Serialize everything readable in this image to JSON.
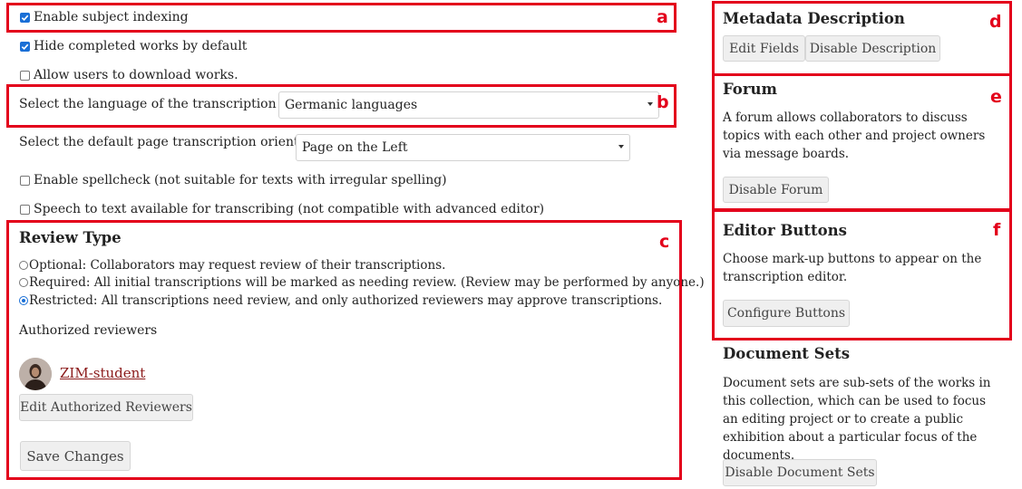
{
  "settings": {
    "enable_subject_indexing": "Enable subject indexing",
    "hide_completed": "Hide completed works by default",
    "allow_download": "Allow users to download works.",
    "language_label": "Select the language of the transcription text",
    "language_value": "Germanic languages",
    "orientation_label": "Select the default page transcription orientation",
    "orientation_value": "Page on the Left",
    "spellcheck": "Enable spellcheck (not suitable for texts with irregular spelling)",
    "speech_to_text": "Speech to text available for transcribing (not compatible with advanced editor)"
  },
  "review": {
    "title": "Review Type",
    "optional": "Optional: Collaborators may request review of their transcriptions.",
    "required": "Required: All initial transcriptions will be marked as needing review. (Review may be performed by anyone.)",
    "restricted": "Restricted: All transcriptions need review, and only authorized reviewers may approve transcriptions.",
    "authorized_label": "Authorized reviewers",
    "reviewer_name": "ZIM-student",
    "edit_reviewers": "Edit Authorized Reviewers",
    "save_changes": "Save Changes"
  },
  "sidebar": {
    "metadata": {
      "title": "Metadata Description",
      "edit_fields": "Edit Fields",
      "disable_description": "Disable Description"
    },
    "forum": {
      "title": "Forum",
      "text": "A forum allows collaborators to discuss topics with each other and project owners via message boards.",
      "disable_forum": "Disable Forum"
    },
    "editor_buttons": {
      "title": "Editor Buttons",
      "text": "Choose mark-up buttons to appear on the transcription editor.",
      "configure": "Configure Buttons"
    },
    "document_sets": {
      "title": "Document Sets",
      "text": "Document sets are sub-sets of the works in this collection, which can be used to focus an editing project or to create a public exhibition about a particular focus of the documents.",
      "disable": "Disable Document Sets"
    }
  },
  "annotation_labels": {
    "a": "a",
    "b": "b",
    "c": "c",
    "d": "d",
    "e": "e",
    "f": "f"
  },
  "colors": {
    "highlight_red": "#e3001b",
    "link": "#8b1a1a",
    "checkbox_accent": "#1a6fd6",
    "button_bg": "#efefef"
  },
  "state": {
    "enable_subject_indexing_checked": true,
    "hide_completed_checked": true,
    "allow_download_checked": false,
    "spellcheck_checked": false,
    "speech_to_text_checked": false,
    "review_selected": "restricted"
  }
}
